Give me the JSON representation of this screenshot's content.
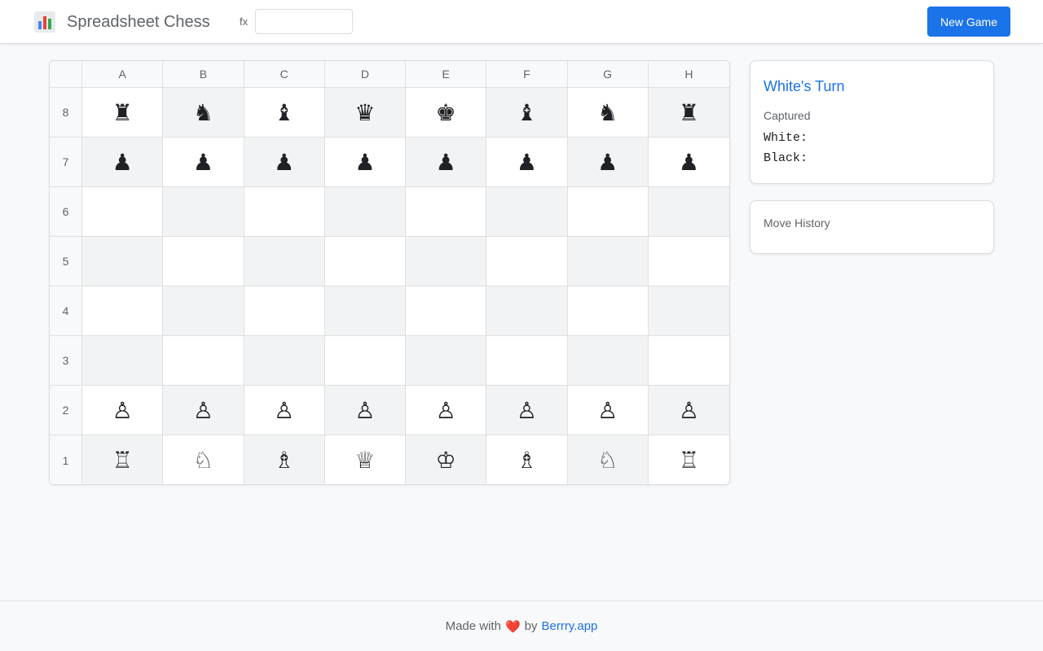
{
  "header": {
    "app_title": "Spreadsheet Chess",
    "logo_icon": "bar-chart-icon",
    "formula_label": "fx",
    "formula_value": "",
    "new_game_label": "New Game"
  },
  "board": {
    "columns": [
      "A",
      "B",
      "C",
      "D",
      "E",
      "F",
      "G",
      "H"
    ],
    "rows": [
      "8",
      "7",
      "6",
      "5",
      "4",
      "3",
      "2",
      "1"
    ],
    "pieces": [
      [
        "♜",
        "♞",
        "♝",
        "♛",
        "♚",
        "♝",
        "♞",
        "♜"
      ],
      [
        "♟",
        "♟",
        "♟",
        "♟",
        "♟",
        "♟",
        "♟",
        "♟"
      ],
      [
        "",
        "",
        "",
        "",
        "",
        "",
        "",
        ""
      ],
      [
        "",
        "",
        "",
        "",
        "",
        "",
        "",
        ""
      ],
      [
        "",
        "",
        "",
        "",
        "",
        "",
        "",
        ""
      ],
      [
        "",
        "",
        "",
        "",
        "",
        "",
        "",
        ""
      ],
      [
        "♙",
        "♙",
        "♙",
        "♙",
        "♙",
        "♙",
        "♙",
        "♙"
      ],
      [
        "♖",
        "♘",
        "♗",
        "♕",
        "♔",
        "♗",
        "♘",
        "♖"
      ]
    ],
    "light_square_color": "#ffffff",
    "dark_square_color": "#f1f3f4"
  },
  "status": {
    "turn": "White's Turn",
    "captured_label": "Captured",
    "white_captured": "White:",
    "black_captured": "Black:"
  },
  "history": {
    "label": "Move History",
    "moves": []
  },
  "footer": {
    "made_with": "Made with",
    "heart": "❤️",
    "by": "by",
    "link_text": "Berrry.app"
  },
  "colors": {
    "accent": "#1a73e8",
    "heart": "#e53935"
  }
}
